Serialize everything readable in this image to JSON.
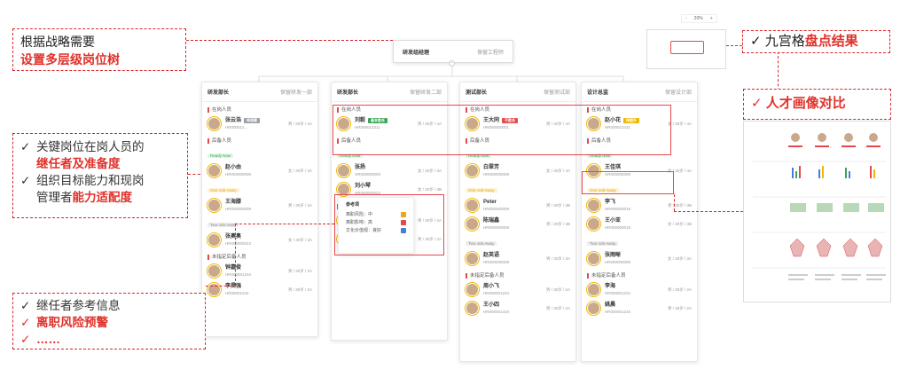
{
  "callouts": {
    "tree": {
      "line1": "根据战略需要",
      "line2": "设置多层级岗位树"
    },
    "ninebox": {
      "check": "✓",
      "text": "九宫格",
      "highlight": "盘点结果"
    },
    "portrait": {
      "check": "✓",
      "text": "人才画像对比"
    },
    "key": {
      "items": [
        {
          "check": "✓",
          "text": "关键岗位在岗人员的",
          "highlight": "继任者及准备度"
        },
        {
          "check": "✓",
          "text": "组织目标能力和现岗",
          "text2": "管理者",
          "highlight": "能力适配度"
        }
      ]
    },
    "succ": {
      "items": [
        {
          "check": "✓",
          "text": "继任者参考信息"
        },
        {
          "check": "✓",
          "highlight": "离职风险预警"
        },
        {
          "check": "✓",
          "highlight": "……"
        }
      ]
    }
  },
  "top_node": {
    "title": "研发组经理",
    "right": "保留工程师"
  },
  "zoom": {
    "minus": "-",
    "value": "20%",
    "plus": "+"
  },
  "columns": [
    {
      "title": "研发部长",
      "right": "保留研发一部",
      "incumbent_label": "在岗人员",
      "incumbent": {
        "name": "张云浩",
        "code": "HR000012...",
        "meta": "男 / 30岁 / 4A",
        "tag": "待观察",
        "tag_color": "#9aa0a6"
      },
      "reserve_label": "后备人员",
      "groups": [
        {
          "status": "Ready Now",
          "cls": "ready",
          "people": [
            {
              "name": "赵小由",
              "code": "HR000000009",
              "meta": "女 / 30岁 / 3A"
            }
          ]
        },
        {
          "status": "One-Job-Away",
          "cls": "one",
          "people": [
            {
              "name": "王海滕",
              "code": "HR000000009",
              "meta": "男 / 30岁 / 3A"
            }
          ]
        },
        {
          "status": "Two-Job-Away",
          "cls": "two",
          "people": [
            {
              "name": "张奥奥",
              "code": "HR000000023",
              "meta": "女 / 30岁 / 3A"
            }
          ]
        }
      ],
      "unassigned_label": "未指定后备人员",
      "unassigned": [
        {
          "name": "钟嘉俊",
          "code": "HR000001234",
          "meta": "男 / 30岁 / 2A"
        },
        {
          "name": "李昊强",
          "code": "HR00001234",
          "meta": "男 / 30岁 / 2A"
        }
      ]
    },
    {
      "title": "研发部长",
      "right": "保留研发二部",
      "incumbent_label": "在岗人员",
      "incumbent": {
        "name": "刘毅",
        "code": "HR000012311",
        "meta": "男 / 30岁 / 4A",
        "tag": "基本胜任",
        "tag_color": "#3aa655"
      },
      "reserve_label": "后备人员",
      "groups": [
        {
          "status": "Ready Now",
          "cls": "ready",
          "people": [
            {
              "name": "张扬",
              "code": "HR000000009",
              "meta": "女 / 30岁 / 3A"
            }
          ]
        },
        {
          "status": "",
          "cls": "",
          "people": [
            {
              "name": "刘小琴",
              "code": "HR000000023",
              "meta": "女 / 30岁 / 3B"
            }
          ]
        }
      ],
      "unassigned_label": "未指定后备人员",
      "unassigned": [
        {
          "name": "赵琦",
          "code": "HR000001234",
          "meta": "男 / 30岁 / 2A"
        },
        {
          "name": "王小梓",
          "code": "HR000001234",
          "meta": "男 / 30岁 / 2A"
        }
      ]
    },
    {
      "title": "测试部长",
      "right": "保留测试部",
      "incumbent_label": "在岗人员",
      "incumbent": {
        "name": "王大同",
        "code": "HR000000001",
        "meta": "男 / 30岁 / 4A",
        "tag": "不胜任",
        "tag_color": "#e5484d"
      },
      "reserve_label": "后备人员",
      "groups": [
        {
          "status": "Ready Now",
          "cls": "ready",
          "people": [
            {
              "name": "白翠芳",
              "code": "HR000000009",
              "meta": "女 / 30岁 / 4A"
            }
          ]
        },
        {
          "status": "One-Job-Away",
          "cls": "one",
          "people": [
            {
              "name": "Peter",
              "code": "HR000000009",
              "meta": "男 / 30岁 / 3B"
            },
            {
              "name": "陈瑞鑫",
              "code": "HR000000009",
              "meta": "男 / 30岁 / 3B"
            }
          ]
        },
        {
          "status": "Two-Job-Away",
          "cls": "two",
          "people": [
            {
              "name": "赵英语",
              "code": "HR000000009",
              "meta": "男 / 30岁 / 3A"
            }
          ]
        }
      ],
      "unassigned_label": "未指定后备人员",
      "unassigned": [
        {
          "name": "周小飞",
          "code": "HR000001234",
          "meta": "男 / 30岁 / 2A"
        },
        {
          "name": "王小四",
          "code": "HR000001234",
          "meta": "男 / 30岁 / 2A"
        }
      ]
    },
    {
      "title": "设计总监",
      "right": "保留设计部",
      "incumbent_label": "在岗人员",
      "incumbent": {
        "name": "赵小花",
        "code": "HR000012431",
        "meta": "女 / 30岁 / 4A",
        "tag": "待提升",
        "tag_color": "#f2b705"
      },
      "reserve_label": "后备人员",
      "groups": [
        {
          "status": "Ready Now",
          "cls": "ready",
          "people": [
            {
              "name": "王佳琪",
              "code": "HR000000009",
              "meta": "女 / 30岁 / 4A"
            }
          ]
        },
        {
          "status": "One-Job-Away",
          "cls": "one",
          "people": [
            {
              "name": "李飞",
              "code": "HR000000019",
              "meta": "男 / 30岁 / 3B"
            },
            {
              "name": "王小亚",
              "code": "HR000000019",
              "meta": "女 / 30岁 / 3B"
            }
          ]
        },
        {
          "status": "Two-Job-Away",
          "cls": "two",
          "people": [
            {
              "name": "张雨晰",
              "code": "HR000000009",
              "meta": "女 / 30岁 / 3A"
            }
          ]
        }
      ],
      "unassigned_label": "未指定后备人员",
      "unassigned": [
        {
          "name": "李海",
          "code": "HR000001234",
          "meta": "男 / 30岁 / 2A"
        },
        {
          "name": "姚晨",
          "code": "HR000001234",
          "meta": "男 / 30岁 / 2A"
        }
      ]
    }
  ],
  "tooltip": {
    "title": "参考项",
    "rows": [
      {
        "label": "离职风险：中",
        "color": "#f2a21b"
      },
      {
        "label": "离职影响：高",
        "color": "#e5484d"
      },
      {
        "label": "文化价值观：良好",
        "color": "#4a7bd8"
      }
    ]
  },
  "colors": {
    "accent": "#e0312a",
    "ready": "#3aa655",
    "one": "#d9a11b"
  }
}
